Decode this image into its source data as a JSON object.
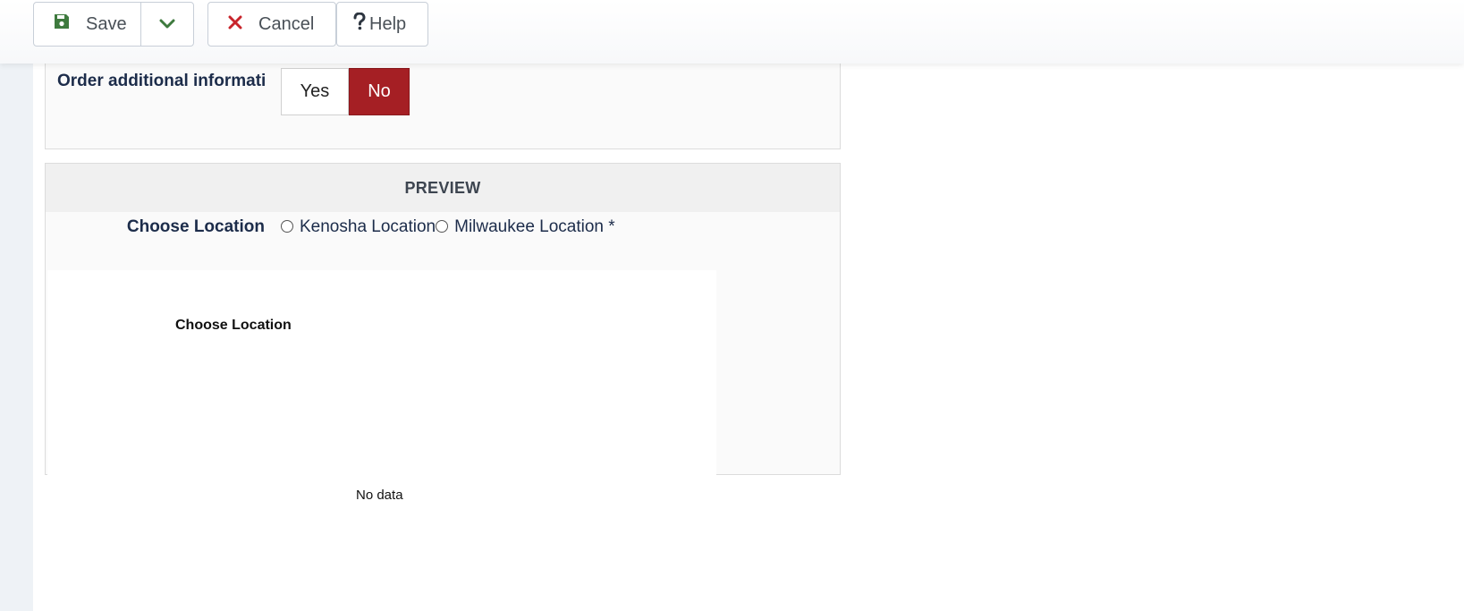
{
  "toolbar": {
    "save_label": "Save",
    "save_icon": "floppy-disk-icon",
    "dropdown_icon": "chevron-down-icon",
    "cancel_label": "Cancel",
    "cancel_icon": "x-icon",
    "help_label": "Help",
    "help_icon": "question-mark-icon"
  },
  "order_info": {
    "label": "Order additional informati",
    "options": [
      "Yes",
      "No"
    ],
    "selected": "No",
    "selected_color": "#a51f24"
  },
  "preview": {
    "header": "PREVIEW",
    "location_label": "Choose Location",
    "radio_options": [
      "Kenosha Location",
      "Milwaukee Location *"
    ],
    "frame_title": "Choose Location",
    "no_data": "No data"
  }
}
